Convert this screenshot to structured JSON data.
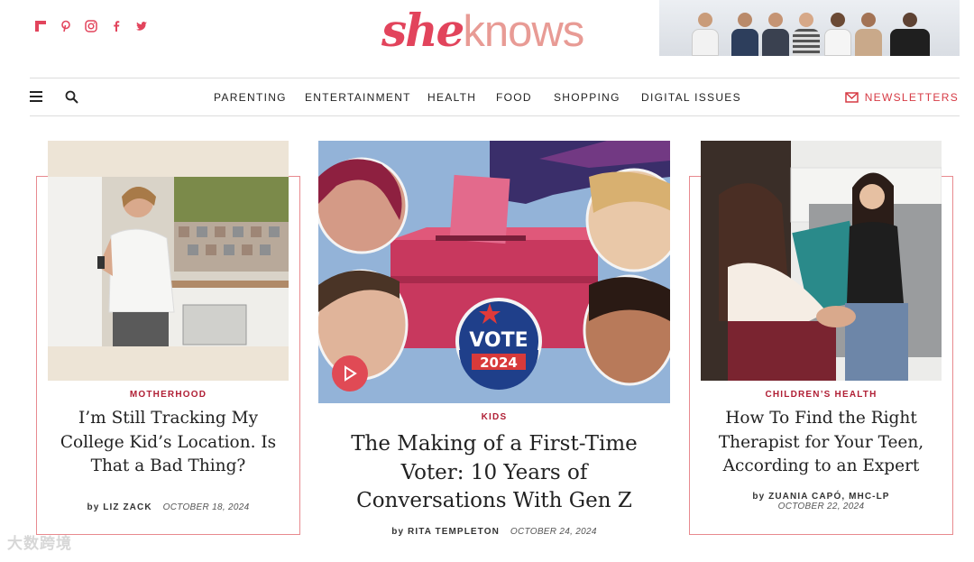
{
  "social": {
    "icons": [
      "flipboard-icon",
      "pinterest-icon",
      "instagram-icon",
      "facebook-icon",
      "twitter-icon"
    ],
    "color": "#e2445c"
  },
  "brand": {
    "logo_part1": "she",
    "logo_part2": "knows",
    "color_primary": "#e2445c",
    "color_secondary": "#e89b95"
  },
  "nav": {
    "items": [
      "PARENTING",
      "ENTERTAINMENT",
      "HEALTH",
      "FOOD",
      "SHOPPING",
      "DIGITAL ISSUES"
    ],
    "newsletters": "NEWSLETTERS",
    "accent": "#d63a44"
  },
  "articles": [
    {
      "category": "MOTHERHOOD",
      "title": "I’m Still Tracking My College Kid’s Location. Is That a Bad Thing?",
      "author": "by LIZ ZACK",
      "date": "OCTOBER 18, 2024"
    },
    {
      "category": "KIDS",
      "title": "The Making of a First-Time Voter: 10 Years of Conversations With Gen Z",
      "author": "by RITA TEMPLETON",
      "date": "OCTOBER 24, 2024",
      "badge_line1": "VOTE",
      "badge_line2": "2024"
    },
    {
      "category": "CHILDREN’S HEALTH",
      "title": "How To Find the Right Therapist for Your Teen, According to an Expert",
      "author": "by ZUANIA CAPÓ, MHC-LP",
      "date": "OCTOBER 22, 2024"
    }
  ],
  "watermark": "大数跨境"
}
